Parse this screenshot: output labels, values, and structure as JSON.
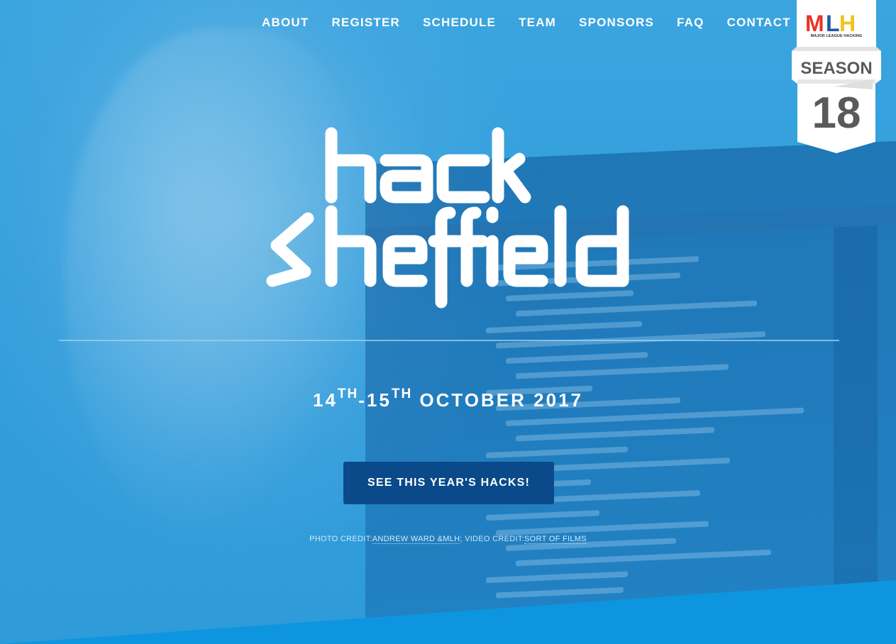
{
  "nav": {
    "items": [
      {
        "label": "ABOUT"
      },
      {
        "label": "REGISTER"
      },
      {
        "label": "SCHEDULE"
      },
      {
        "label": "TEAM"
      },
      {
        "label": "SPONSORS"
      },
      {
        "label": "FAQ"
      },
      {
        "label": "CONTACT"
      }
    ]
  },
  "mlh_badge": {
    "logo_text": "MLH",
    "subtitle": "MAJOR LEAGUE HACKING",
    "season_label": "SEASON",
    "season_number": "18"
  },
  "hero": {
    "logo_line1": "hack",
    "logo_line2": "sheffield",
    "date_day1": "14",
    "date_sup1": "TH",
    "date_sep": "-",
    "date_day2": "15",
    "date_sup2": "TH",
    "date_rest": " OCTOBER 2017",
    "cta_label": "SEE THIS YEAR'S HACKS!"
  },
  "credits": {
    "photo_prefix": "PHOTO CREDIT:",
    "photo_link": "ANDREW WARD &MLH",
    "separator": "; ",
    "video_prefix": "VIDEO CREDIT:",
    "video_link": "SORT OF FILMS"
  },
  "colors": {
    "background": "#2f9fdc",
    "button": "#0a4a8a",
    "text": "#ffffff"
  }
}
